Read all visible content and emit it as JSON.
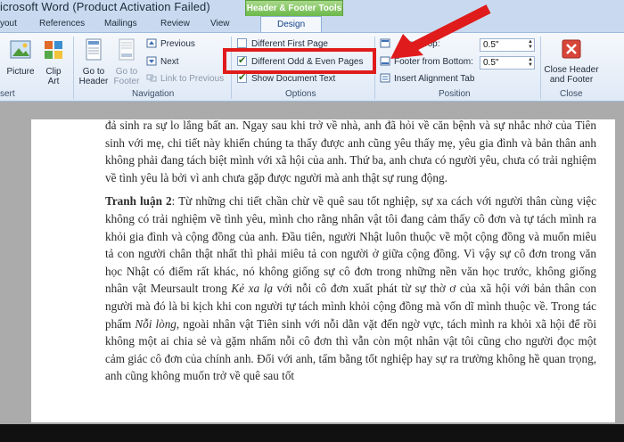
{
  "window": {
    "title": "icrosoft Word (Product Activation Failed)",
    "context_group": "Header & Footer Tools"
  },
  "tabs": [
    "yout",
    "References",
    "Mailings",
    "Review",
    "View",
    "Design"
  ],
  "ribbon": {
    "insert_group": {
      "label": "sert",
      "picture": "Picture",
      "clip_art": "Clip Art"
    },
    "navigation": {
      "label": "Navigation",
      "go_to_header": "Go to Header",
      "go_to_footer": "Go to Footer",
      "previous": "Previous",
      "next": "Next",
      "link_to_previous": "Link to Previous"
    },
    "options": {
      "label": "Options",
      "different_first_page": "Different First Page",
      "different_odd_even": "Different Odd & Even Pages",
      "show_document_text": "Show Document Text"
    },
    "position": {
      "label": "Position",
      "header_from_top_label": "from Top:",
      "header_from_top_value": "0.5\"",
      "footer_from_bottom_label": "Footer from Bottom:",
      "footer_from_bottom_value": "0.5\"",
      "insert_alignment_tab": "Insert Alignment Tab"
    },
    "close": {
      "label": "Close",
      "close_btn": "Close Header and Footer"
    }
  },
  "document": {
    "p1": "đả sinh ra sự lo lắng bất an. Ngay sau khi trở về nhà, anh đã hỏi về căn bệnh và sự nhắc nhở của Tiên sinh với mẹ, chi tiết này khiến chúng ta thấy được anh cũng yêu thấy mẹ, yêu gia đình và bản thân anh không phải đang tách biệt mình với xã hội của anh. Thứ ba, anh chưa có người yêu, chưa có trải nghiệm về tình yêu là bởi vì anh chưa gặp được người mà anh thật sự rung động.",
    "p2_label": "Tranh luận 2",
    "p2_a": ": Từ những chi tiết chần chừ về quê sau tốt nghiệp, sự xa cách với người thân cùng việc không có trải nghiệm về tình yêu, mình cho rằng nhân vật tôi đang cảm thấy cô đơn và tự tách mình ra khỏi gia đình và cộng đồng của anh. Đầu tiên, người Nhật luôn thuộc về một cộng đồng và muốn miêu tả con người chân thật nhất thì phải miêu tả con người ở giữa cộng đồng. Vì vậy sự cô đơn trong văn học Nhật có điểm rất khác, nó không giống sự cô đơn trong những nền văn học trước, không giống nhân vật Meursault trong ",
    "p2_em1": "Kẻ xa lạ",
    "p2_b": " với nỗi cô đơn xuất phát từ sự thờ ơ của xã hội với bản thân con người  mà đó là bi kịch khi con người tự tách mình khỏi cộng đồng mà vốn dĩ mình thuộc về. Trong tác phẩm ",
    "p2_em2": "Nỗi lòng",
    "p2_c": ", ngoài nhân vật Tiên sinh với nỗi dằn vặt đến ngờ vực, tách mình ra khỏi xã hội để rồi không một ai chia sẻ và gặm nhấm nỗi cô đơn thì vẫn còn một nhân vật tôi cũng cho người đọc một cảm giác cô đơn của chính anh. Đối với anh, tấm bằng tốt nghiệp hay sự ra trường không hề quan trọng, anh cũng không muốn trở về quê sau tốt"
  },
  "colors": {
    "highlight_box": "#e01b1b",
    "arrow": "#e01b1b",
    "ribbon_bg": "#dfe9f6"
  }
}
